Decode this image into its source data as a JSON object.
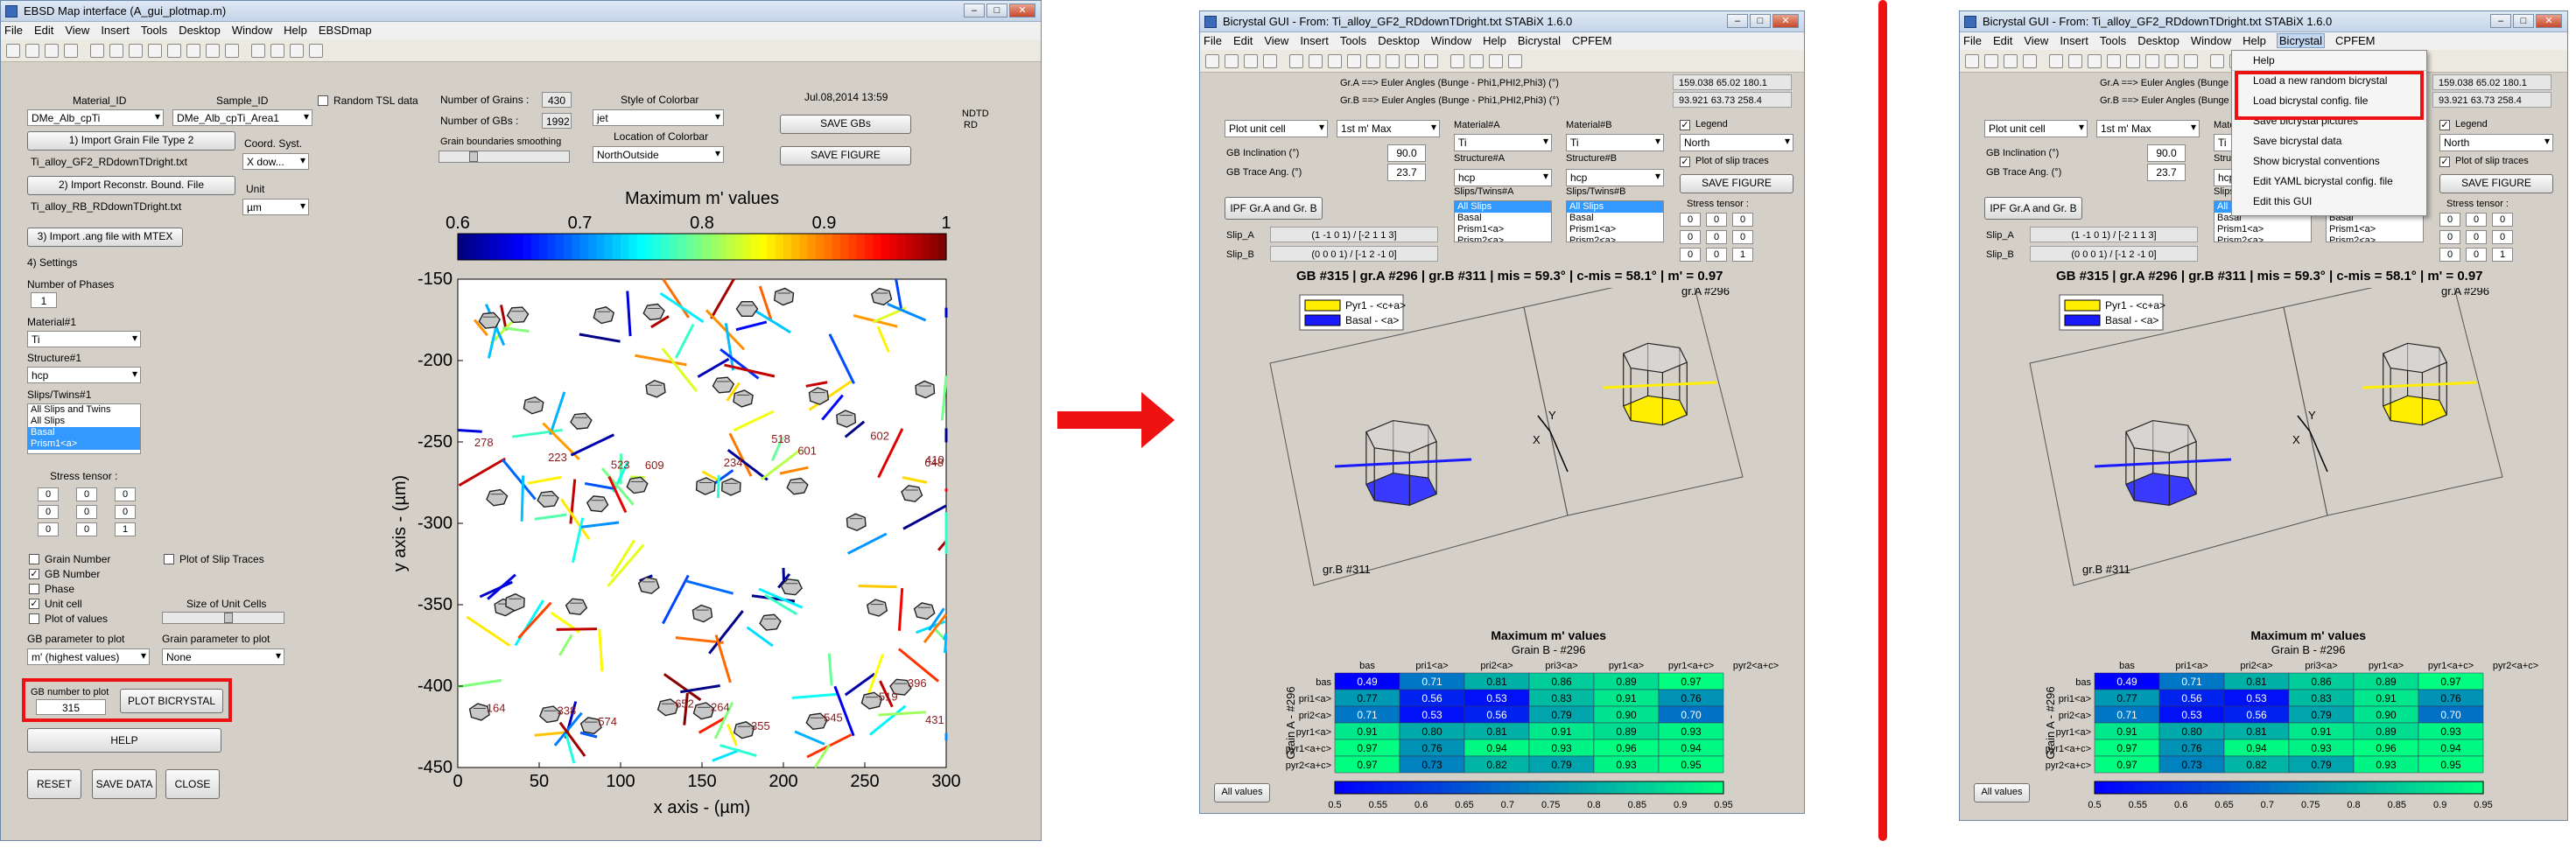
{
  "w1": {
    "title": "EBSD Map interface (A_gui_plotmap.m)",
    "menus": [
      "File",
      "Edit",
      "View",
      "Insert",
      "Tools",
      "Desktop",
      "Window",
      "Help",
      "EBSDmap"
    ],
    "material_id_label": "Material_ID",
    "sample_id_label": "Sample_ID",
    "material_id_value": "DMe_Alb_cpTi",
    "sample_id_value": "DMe_Alb_cpTi_Area1",
    "random_tsl": "Random TSL data",
    "import_grain_btn": "1) Import Grain File Type 2",
    "grain_file": "Ti_alloy_GF2_RDdownTDright.txt",
    "import_recon_btn": "2) Import Reconstr. Bound. File",
    "recon_file": "Ti_alloy_RB_RDdownTDright.txt",
    "coord_label": "Coord. Syst.",
    "coord_value": "X dow...",
    "unit_label": "Unit",
    "unit_value": "µm",
    "mtex_btn": "3) Import .ang file with MTEX",
    "settings": "4) Settings",
    "num_phases_label": "Number of Phases",
    "num_phases": "1",
    "material1_label": "Material#1",
    "material1": "Ti",
    "structure1_label": "Structure#1",
    "structure1": "hcp",
    "slips_label": "Slips/Twins#1",
    "slips": [
      "All Slips and Twins",
      "All Slips",
      "Basal",
      "Prism1<a>"
    ],
    "stress_label": "Stress tensor :",
    "stress": [
      "0",
      "0",
      "0",
      "0",
      "0",
      "0",
      "0",
      "0",
      "1"
    ],
    "grain_number": "Grain Number",
    "gb_number": "GB Number",
    "phase": "Phase",
    "unit_cell": "Unit cell",
    "plot_values": "Plot of values",
    "plot_slip_traces": "Plot of Slip Traces",
    "size_unit_cells": "Size of Unit Cells",
    "gb_param_label": "GB parameter to plot",
    "gb_param": "m' (highest values)",
    "grain_param_label": "Grain parameter to plot",
    "grain_param": "None",
    "gb_plot_label": "GB number to plot",
    "gb_plot_value": "315",
    "plot_bicrystal_btn": "PLOT BICRYSTAL",
    "help_btn": "HELP",
    "reset_btn": "RESET",
    "save_data_btn": "SAVE DATA",
    "close_btn": "CLOSE",
    "num_grains_label": "Number of Grains :",
    "num_grains": "430",
    "num_gbs_label": "Number of GBs :",
    "num_gbs": "1992",
    "gb_smoothing": "Grain boundaries smoothing",
    "style_colorbar_label": "Style of Colorbar",
    "style_colorbar": "jet",
    "location_colorbar_label": "Location of Colorbar",
    "location_colorbar": "NorthOutside",
    "date": "Jul.08,2014 13:59",
    "save_gbs_btn": "SAVE GBs",
    "save_figure_btn": "SAVE FIGURE",
    "nd": "ND",
    "td": "TD",
    "rd": "RD",
    "map_title": "Maximum m' values",
    "xlabel": "x axis - (µm)",
    "ylabel": "y axis - (µm)"
  },
  "map_chart": {
    "type": "heatmap",
    "title": "Maximum m' values",
    "colorbar": {
      "min": 0.6,
      "max": 1,
      "ticks": [
        "0.6",
        "0.7",
        "0.8",
        "0.9",
        "1"
      ],
      "colormap": "jet",
      "location": "NorthOutside"
    },
    "xlabel": "x axis - (µm)",
    "ylabel": "y axis - (µm)",
    "xlim": [
      0,
      300
    ],
    "ylim": [
      -450,
      -150
    ],
    "xticks": [
      "0",
      "50",
      "100",
      "150",
      "200",
      "250",
      "300"
    ],
    "yticks": [
      "-150",
      "-200",
      "-250",
      "-300",
      "-350",
      "-400",
      "-450"
    ],
    "gb_labels": [
      "278",
      "164",
      "223",
      "338",
      "523",
      "574",
      "609",
      "652",
      "234",
      "264",
      "518",
      "355",
      "601",
      "545",
      "602",
      "519",
      "648",
      "396",
      "410",
      "431"
    ]
  },
  "w2": {
    "title": "Bicrystal GUI - From: Ti_alloy_GF2_RDdownTDright.txt STABiX 1.6.0",
    "menus": [
      "File",
      "Edit",
      "View",
      "Insert",
      "Tools",
      "Desktop",
      "Window",
      "Help",
      "Bicrystal",
      "CPFEM"
    ],
    "gra_label": "Gr.A ==> Euler Angles (Bunge - Phi1,PHI2,Phi3) (°)",
    "gra_value": "159.038  65.02  180.1",
    "grb_label": "Gr.B ==> Euler Angles (Bunge - Phi1,PHI2,Phi3) (°)",
    "grb_value": "93.921  63.73  258.4",
    "plot_unit_cell": "Plot unit cell",
    "first_max": "1st m' Max",
    "matA_label": "Material#A",
    "matA": "Ti",
    "matB_label": "Material#B",
    "matB": "Ti",
    "gb_incl_label": "GB Inclination (°)",
    "gb_incl": "90.0",
    "gb_trace_label": "GB Trace Ang. (°)",
    "gb_trace": "23.7",
    "structA_label": "Structure#A",
    "structA": "hcp",
    "structB_label": "Structure#B",
    "structB": "hcp",
    "slipsA_label": "Slips/Twins#A",
    "slipsB_label": "Slips/Twins#B",
    "slipsA": [
      "All Slips",
      "Basal",
      "Prism1<a>",
      "Prism2<a>"
    ],
    "slipsB": [
      "All Slips",
      "Basal",
      "Prism1<a>",
      "Prism2<a>"
    ],
    "legend": "Legend",
    "legend_pos": "North",
    "plot_slip_traces": "Plot of slip traces",
    "save_figure": "SAVE FIGURE",
    "stress_label": "Stress tensor :",
    "stress": [
      "0",
      "0",
      "0",
      "0",
      "0",
      "0",
      "0",
      "0",
      "1"
    ],
    "ipf_btn": "IPF Gr.A and Gr. B",
    "slipA_label": "Slip_A",
    "slipA": "(1 -1 0 1) / [-2 1 1 3]",
    "slipB_label": "Slip_B",
    "slipB": "(0 0 0 1) / [-1 2 -1 0]",
    "gb_info": "GB #315 | gr.A #296 | gr.B #311 | mis = 59.3° | c-mis = 58.1° | m' = 0.97",
    "legend_items": [
      "Pyr1 - <c+a>",
      "Basal - <a>"
    ],
    "grA": "gr.A #296",
    "grB": "gr.B #311",
    "axX": "X",
    "axY": "Y",
    "all_values": "All values"
  },
  "bicrystal_chart": {
    "type": "heatmap",
    "title": "Maximum m' values",
    "xlabel": "Grain B - #296",
    "ylabel": "Grain A - #296",
    "columns": [
      "bas",
      "pri1<a>",
      "pri2<a>",
      "pri3<a>",
      "pyr1<a>",
      "pyr1<a+c>",
      "pyr2<a+c>"
    ],
    "rows": [
      "bas",
      "pri1<a>",
      "pri2<a>",
      "pyr1<a>",
      "pyr1<a+c>",
      "pyr2<a+c>"
    ],
    "values": [
      [
        "0.49",
        "0.71",
        "0.81",
        "0.86",
        "0.89",
        "0.97"
      ],
      [
        "0.77",
        "0.56",
        "0.53",
        "0.83",
        "0.91",
        "0.76"
      ],
      [
        "0.71",
        "0.53",
        "0.56",
        "0.79",
        "0.90",
        "0.70"
      ],
      [
        "0.91",
        "0.80",
        "0.81",
        "0.91",
        "0.89",
        "0.93"
      ],
      [
        "0.97",
        "0.76",
        "0.94",
        "0.93",
        "0.96",
        "0.94"
      ],
      [
        "0.97",
        "0.73",
        "0.82",
        "0.79",
        "0.93",
        "0.95"
      ]
    ],
    "colorbar": {
      "min": 0.5,
      "max": 0.95,
      "ticks": [
        "0.5",
        "0.55",
        "0.6",
        "0.65",
        "0.7",
        "0.75",
        "0.8",
        "0.85",
        "0.9",
        "0.95"
      ],
      "colormap": "winter"
    }
  },
  "w3": {
    "menu_items": [
      "Help",
      "Load a new random bicrystal",
      "Load bicrystal config. file",
      "Save bicrystal pictures",
      "Save bicrystal data",
      "Show bicrystal conventions",
      "Edit YAML bicrystal config. file",
      "Edit this GUI"
    ]
  },
  "colors": {
    "highlight": "#ee1111",
    "arrow": "#ee1111",
    "window_bg": "#d4d0c8"
  }
}
